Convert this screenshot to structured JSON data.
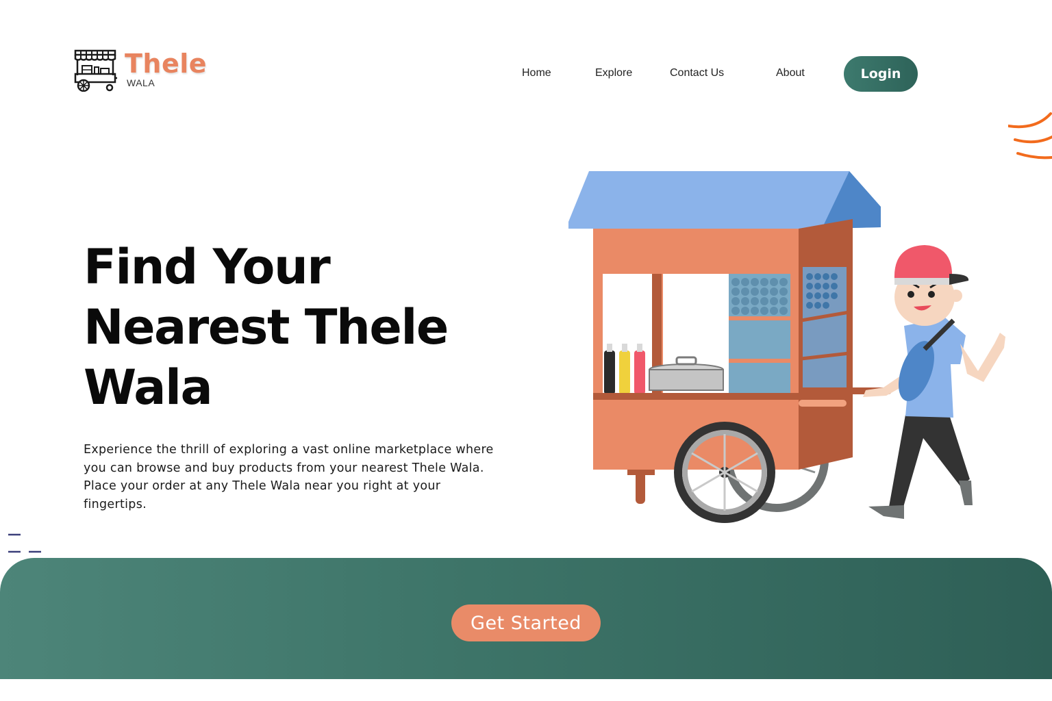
{
  "brand": {
    "name": "Thele",
    "subtitle": "WALA",
    "logo_icon": "food-cart-icon",
    "accent_color": "#e8845f"
  },
  "nav": {
    "items": [
      {
        "label": "Home"
      },
      {
        "label": "Explore"
      },
      {
        "label": "Contact Us"
      },
      {
        "label": "About"
      }
    ],
    "login_label": "Login",
    "login_color": "#2e6359"
  },
  "hero": {
    "title_line1": "Find Your",
    "title_line2": "Nearest Thele",
    "title_line3": "Wala",
    "description": "Experience the thrill of exploring a vast online marketplace where you can browse and buy products from your nearest Thele Wala. Place your order at any Thele Wala near you right at your fingertips.",
    "illustration": "street-vendor-cart-illustration"
  },
  "cta": {
    "label": "Get Started",
    "button_color": "#e98b68",
    "band_color": "#3d7468"
  }
}
